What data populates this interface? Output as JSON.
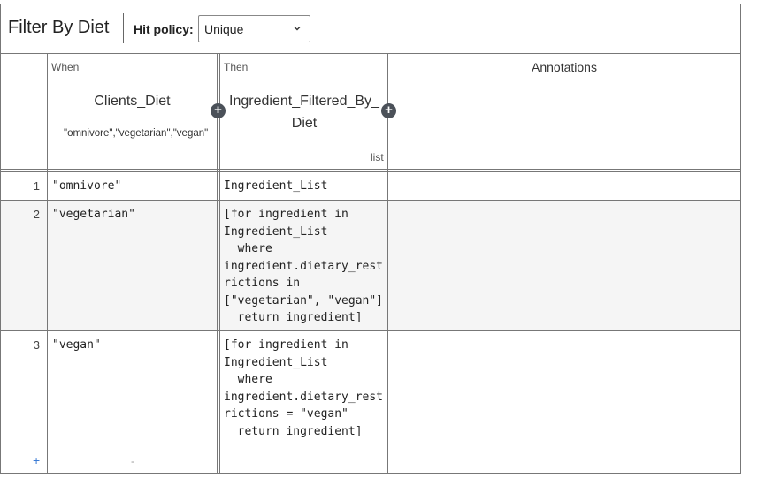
{
  "table": {
    "title": "Filter By Diet",
    "hit_policy_label": "Hit policy:",
    "hit_policy_value": "Unique",
    "when_label": "When",
    "then_label": "Then",
    "input_column": "Clients_Diet",
    "input_allowed_values": "\"omnivore\",\"vegetarian\",\"vegan\"",
    "output_column": "Ingredient_Filtered_By_Diet",
    "output_type": "list",
    "annotations_label": "Annotations",
    "add_rule_label": "+",
    "empty_cell": "-"
  },
  "rules": [
    {
      "num": "1",
      "input": "\"omnivore\"",
      "output": "Ingredient_List",
      "annotation": ""
    },
    {
      "num": "2",
      "input": "\"vegetarian\"",
      "output": "[for ingredient in\nIngredient_List\n  where\ningredient.dietary_rest\nrictions in\n[\"vegetarian\", \"vegan\"]\n  return ingredient]",
      "annotation": ""
    },
    {
      "num": "3",
      "input": "\"vegan\"",
      "output": "[for ingredient in\nIngredient_List\n  where\ningredient.dietary_rest\nrictions = \"vegan\"\n  return ingredient]",
      "annotation": ""
    }
  ],
  "icons": {
    "add_input": "plus-circle",
    "add_output": "plus-circle",
    "select_arrow": "chevron-down"
  }
}
